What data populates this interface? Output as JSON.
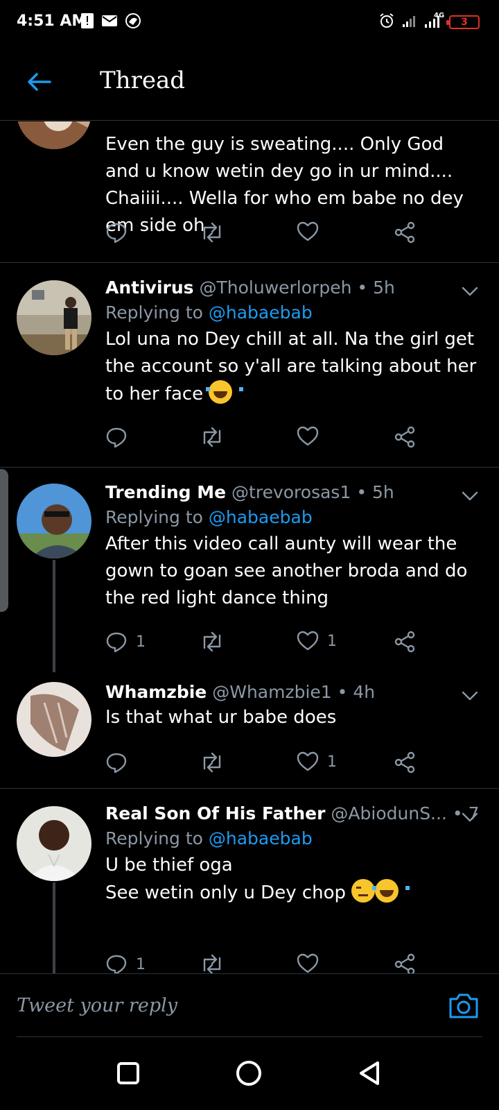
{
  "status_bar": {
    "time": "4:51 AM",
    "network_tag": "4G",
    "battery_level": "3",
    "accent": "#e0302c"
  },
  "header": {
    "title": "Thread",
    "accent": "#1d9bf0"
  },
  "tweets": [
    {
      "name": "",
      "handle": "",
      "time": "",
      "replying_label": "",
      "replying_to": "",
      "text": "Even the guy is sweating.... Only God and u know wetin dey go in ur mind.... Chaiiii.... Wella for who em babe no dey em side oh",
      "replies": "",
      "likes": ""
    },
    {
      "name": "Antivirus",
      "handle": "@Tholuwerlorpeh",
      "time": "5h",
      "replying_label": "Replying to ",
      "replying_to": "@habaebab",
      "text": "Lol una no Dey chill at all. Na the girl get the account so y'all are talking about her to her face",
      "replies": "",
      "likes": ""
    },
    {
      "name": "Trending Me",
      "handle": "@trevorosas1",
      "time": "5h",
      "replying_label": "Replying to ",
      "replying_to": "@habaebab",
      "text": "After this video call aunty will wear the gown to goan see another broda and do the red light dance thing",
      "replies": "1",
      "likes": "1"
    },
    {
      "name": "Whamzbie",
      "handle": "@Whamzbie1",
      "time": "4h",
      "replying_label": "",
      "replying_to": "",
      "text": "Is that what ur babe does",
      "replies": "",
      "likes": "1"
    },
    {
      "name": "Real Son Of His Father",
      "handle": "@AbiodunS...",
      "time": "7h",
      "replying_label": "Replying to ",
      "replying_to": "@habaebab",
      "text_line1": "U be thief oga",
      "text_line2": "See wetin only u Dey chop",
      "replies": "1",
      "likes": ""
    }
  ],
  "separator": "•",
  "composer": {
    "placeholder": "Tweet your reply"
  },
  "icons": [
    "back-arrow-icon",
    "reply-icon",
    "retweet-icon",
    "like-icon",
    "share-icon",
    "caret-down-icon",
    "camera-icon",
    "square-icon",
    "circle-icon",
    "triangle-back-icon"
  ]
}
